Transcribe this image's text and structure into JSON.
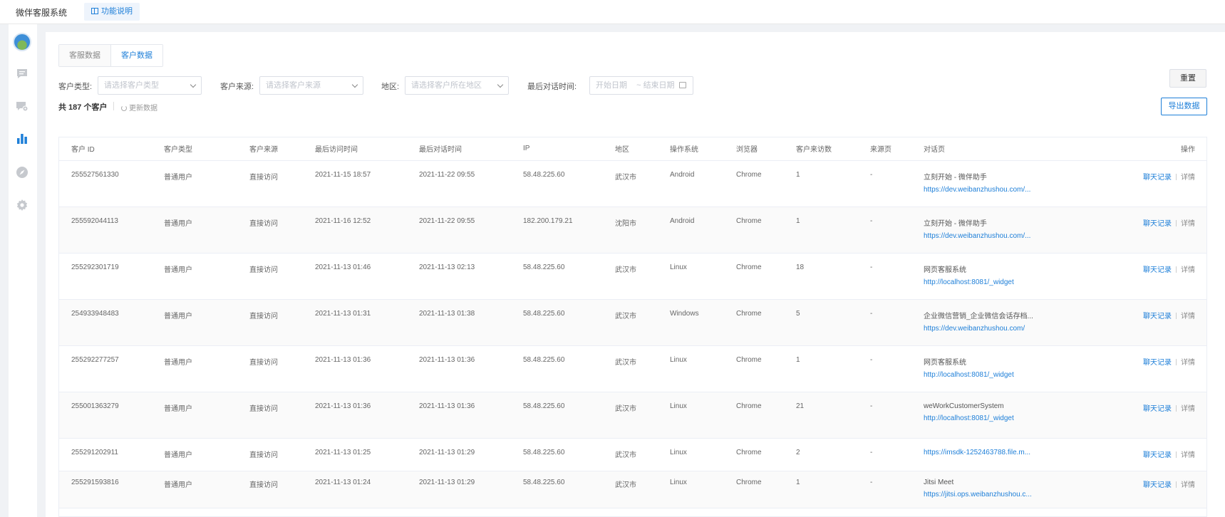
{
  "app": {
    "title": "微伴客服系统",
    "help_label": "功能说明"
  },
  "sidebar": {
    "icons": [
      "message-icon",
      "chat-settings-icon",
      "bar-chart-icon",
      "compass-icon",
      "gear-icon"
    ]
  },
  "tabs": [
    {
      "label": "客服数据",
      "active": false
    },
    {
      "label": "客户数据",
      "active": true
    }
  ],
  "filters": {
    "customer_type": {
      "label": "客户类型:",
      "placeholder": "请选择客户类型"
    },
    "customer_source": {
      "label": "客户来源:",
      "placeholder": "请选择客户来源"
    },
    "region": {
      "label": "地区:",
      "placeholder": "请选择客户所在地区"
    },
    "last_chat_time": {
      "label": "最后对话时间:",
      "start": "开始日期",
      "separator": "~",
      "end": "结束日期"
    },
    "reset_label": "重置"
  },
  "summary": {
    "text": "共 187 个客户",
    "refresh_label": "更新数据",
    "export_label": "导出数据"
  },
  "table": {
    "columns": [
      "客户 ID",
      "客户类型",
      "客户来源",
      "最后访问时间",
      "最后对话时间",
      "IP",
      "地区",
      "操作系统",
      "浏览器",
      "客户来访数",
      "来源页",
      "对话页",
      "操作"
    ],
    "op_chat": "聊天记录",
    "op_detail": "详情",
    "rows": [
      {
        "id": "255527561330",
        "type": "普通用户",
        "source": "直接访问",
        "last_visit": "2021-11-15 18:57",
        "last_chat": "2021-11-22 09:55",
        "ip": "58.48.225.60",
        "region": "武汉市",
        "os": "Android",
        "browser": "Chrome",
        "visits": "1",
        "ref": "-",
        "page_title": "立刻开始 - 微伴助手",
        "page_url": "https://dev.weibanzhushou.com/..."
      },
      {
        "id": "255592044113",
        "type": "普通用户",
        "source": "直接访问",
        "last_visit": "2021-11-16 12:52",
        "last_chat": "2021-11-22 09:55",
        "ip": "182.200.179.21",
        "region": "沈阳市",
        "os": "Android",
        "browser": "Chrome",
        "visits": "1",
        "ref": "-",
        "page_title": "立刻开始 - 微伴助手",
        "page_url": "https://dev.weibanzhushou.com/..."
      },
      {
        "id": "255292301719",
        "type": "普通用户",
        "source": "直接访问",
        "last_visit": "2021-11-13 01:46",
        "last_chat": "2021-11-13 02:13",
        "ip": "58.48.225.60",
        "region": "武汉市",
        "os": "Linux",
        "browser": "Chrome",
        "visits": "18",
        "ref": "-",
        "page_title": "网页客服系统",
        "page_url": "http://localhost:8081/_widget"
      },
      {
        "id": "254933948483",
        "type": "普通用户",
        "source": "直接访问",
        "last_visit": "2021-11-13 01:31",
        "last_chat": "2021-11-13 01:38",
        "ip": "58.48.225.60",
        "region": "武汉市",
        "os": "Windows",
        "browser": "Chrome",
        "visits": "5",
        "ref": "-",
        "page_title": "企业微信营销_企业微信会话存档...",
        "page_url": "https://dev.weibanzhushou.com/"
      },
      {
        "id": "255292277257",
        "type": "普通用户",
        "source": "直接访问",
        "last_visit": "2021-11-13 01:36",
        "last_chat": "2021-11-13 01:36",
        "ip": "58.48.225.60",
        "region": "武汉市",
        "os": "Linux",
        "browser": "Chrome",
        "visits": "1",
        "ref": "-",
        "page_title": "网页客服系统",
        "page_url": "http://localhost:8081/_widget"
      },
      {
        "id": "255001363279",
        "type": "普通用户",
        "source": "直接访问",
        "last_visit": "2021-11-13 01:36",
        "last_chat": "2021-11-13 01:36",
        "ip": "58.48.225.60",
        "region": "武汉市",
        "os": "Linux",
        "browser": "Chrome",
        "visits": "21",
        "ref": "-",
        "page_title": "weWorkCustomerSystem",
        "page_url": "http://localhost:8081/_widget"
      },
      {
        "id": "255291202911",
        "type": "普通用户",
        "source": "直接访问",
        "last_visit": "2021-11-13 01:25",
        "last_chat": "2021-11-13 01:29",
        "ip": "58.48.225.60",
        "region": "武汉市",
        "os": "Linux",
        "browser": "Chrome",
        "visits": "2",
        "ref": "-",
        "page_title": "",
        "page_url": "https://imsdk-1252463788.file.m..."
      },
      {
        "id": "255291593816",
        "type": "普通用户",
        "source": "直接访问",
        "last_visit": "2021-11-13 01:24",
        "last_chat": "2021-11-13 01:29",
        "ip": "58.48.225.60",
        "region": "武汉市",
        "os": "Linux",
        "browser": "Chrome",
        "visits": "1",
        "ref": "-",
        "page_title": "Jitsi Meet",
        "page_url": "https://jitsi.ops.weibanzhushou.c..."
      }
    ]
  }
}
